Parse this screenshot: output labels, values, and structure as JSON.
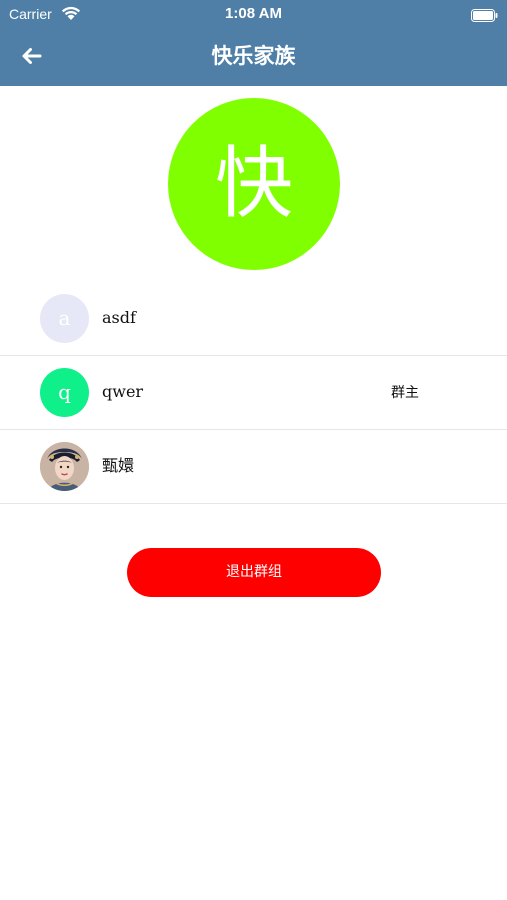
{
  "status_bar": {
    "carrier": "Carrier",
    "time": "1:08 AM",
    "wifi_icon": "wifi-icon",
    "battery_icon": "battery-icon"
  },
  "navbar": {
    "title": "快乐家族",
    "back_icon": "arrow-left-icon",
    "background": "#4f7fa7"
  },
  "group": {
    "avatar_char": "快",
    "avatar_color": "#7fff00"
  },
  "members": [
    {
      "avatar_char": "a",
      "avatar_color": "#e6e8f8",
      "name": "asdf",
      "role": ""
    },
    {
      "avatar_char": "q",
      "avatar_color": "#0ff08a",
      "name": "qwer",
      "role": "群主"
    },
    {
      "avatar_char": "",
      "avatar_color": "#d8c7bb",
      "name": "甄嬛",
      "role": ""
    }
  ],
  "actions": {
    "leave_group": "退出群组",
    "leave_color": "#ff0000"
  }
}
